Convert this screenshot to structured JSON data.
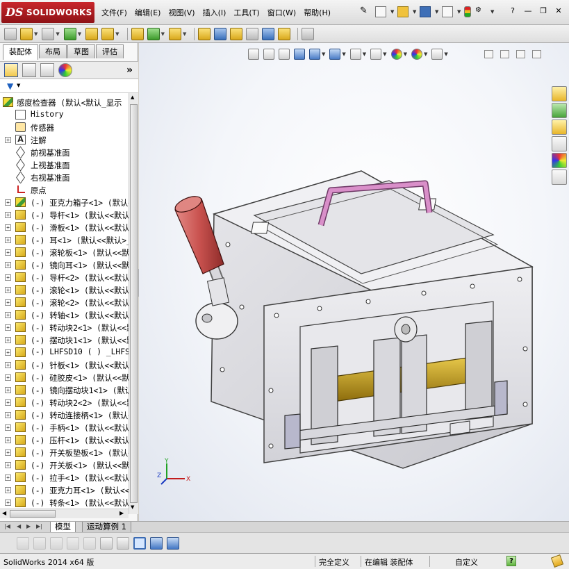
{
  "app": {
    "logo_ds": "DS",
    "logo_name": "SOLIDWORKS"
  },
  "menu": [
    "文件(F)",
    "编辑(E)",
    "视图(V)",
    "插入(I)",
    "工具(T)",
    "窗口(W)",
    "帮助(H)"
  ],
  "window_controls": {
    "minimize": "—",
    "restore": "❐",
    "close": "✕",
    "help": "?"
  },
  "left_panel": {
    "tabs": [
      "装配体",
      "布局",
      "草图",
      "评估"
    ],
    "active_tab": "装配体",
    "feature_manager_more": "»",
    "filter_icon": "filter-funnel-icon",
    "tree": [
      {
        "expander": "",
        "icon": "assembly",
        "label": "感度检查器  (默认<默认_显示"
      },
      {
        "expander": "",
        "icon": "history",
        "label": "History"
      },
      {
        "expander": "",
        "icon": "sensor",
        "label": "传感器"
      },
      {
        "expander": "+",
        "icon": "note",
        "icon_text": "A",
        "label": "注解"
      },
      {
        "expander": "",
        "icon": "plane",
        "label": "前视基准面"
      },
      {
        "expander": "",
        "icon": "plane",
        "label": "上视基准面"
      },
      {
        "expander": "",
        "icon": "plane",
        "label": "右视基准面"
      },
      {
        "expander": "",
        "icon": "origin",
        "label": "原点"
      },
      {
        "expander": "+",
        "icon": "assembly",
        "label": "(-) 亚克力箱子<1> (默认<"
      },
      {
        "expander": "+",
        "icon": "part",
        "label": "(-) 导杆<1> (默认<<默认"
      },
      {
        "expander": "+",
        "icon": "part",
        "label": "(-) 滑板<1> (默认<<默认"
      },
      {
        "expander": "+",
        "icon": "part",
        "label": "(-) 耳<1> (默认<<默认>_"
      },
      {
        "expander": "+",
        "icon": "part",
        "label": "(-) 滚轮板<1> (默认<<默"
      },
      {
        "expander": "+",
        "icon": "part",
        "label": "(-) 镜向耳<1> (默认<<默"
      },
      {
        "expander": "+",
        "icon": "part",
        "label": "(-) 导杆<2> (默认<<默认"
      },
      {
        "expander": "+",
        "icon": "part",
        "label": "(-) 滚轮<1> (默认<<默认"
      },
      {
        "expander": "+",
        "icon": "part",
        "label": "(-) 滚轮<2> (默认<<默认"
      },
      {
        "expander": "+",
        "icon": "part",
        "label": "(-) 转轴<1> (默认<<默认"
      },
      {
        "expander": "+",
        "icon": "part",
        "label": "(-) 转动块2<1> (默认<<默"
      },
      {
        "expander": "+",
        "icon": "part",
        "label": "(-) 摆动块1<1> (默认<<默"
      },
      {
        "expander": "+",
        "icon": "part",
        "label": "(-) LHFSD10 ( ) _LHFSD10"
      },
      {
        "expander": "+",
        "icon": "part",
        "label": "(-) 针板<1> (默认<<默认"
      },
      {
        "expander": "+",
        "icon": "part",
        "label": "(-) 硅胶皮<1> (默认<<默"
      },
      {
        "expander": "+",
        "icon": "part",
        "label": "(-) 镜向摆动块1<1> (默认"
      },
      {
        "expander": "+",
        "icon": "part",
        "label": "(-) 转动块2<2> (默认<<默"
      },
      {
        "expander": "+",
        "icon": "part",
        "label": "(-) 转动连接柄<1> (默认<"
      },
      {
        "expander": "+",
        "icon": "part",
        "label": "(-) 手柄<1> (默认<<默认"
      },
      {
        "expander": "+",
        "icon": "part",
        "label": "(-) 压杆<1> (默认<<默认"
      },
      {
        "expander": "+",
        "icon": "part",
        "label": "(-) 开关板垫板<1> (默认<"
      },
      {
        "expander": "+",
        "icon": "part",
        "label": "(-) 开关板<1> (默认<<默"
      },
      {
        "expander": "+",
        "icon": "part",
        "label": "(-) 拉手<1> (默认<<默认"
      },
      {
        "expander": "+",
        "icon": "part",
        "label": "(-) 亚克力耳<1> (默认<<"
      },
      {
        "expander": "+",
        "icon": "part",
        "label": "(-) 转条<1> (默认<<默认"
      }
    ]
  },
  "viewport": {
    "axis_labels": {
      "x": "X",
      "y": "Y",
      "z": "Z"
    },
    "colors": {
      "box_body": "#d8d8dc",
      "box_edge": "#404040",
      "handle_grip": "#c9524f",
      "pull_handle": "#d98fc9",
      "slide_parts": "#b8941a",
      "background_top": "#ffffff",
      "background_edge": "#dfe4ee"
    }
  },
  "bottom_tabs": [
    "模型",
    "运动算例 1"
  ],
  "bottom_active_tab": "模型",
  "status_bar": {
    "product": "SolidWorks 2014 x64 版",
    "definition": "完全定义",
    "editing": "在编辑 装配体",
    "units": "自定义",
    "help_icon": "?"
  }
}
